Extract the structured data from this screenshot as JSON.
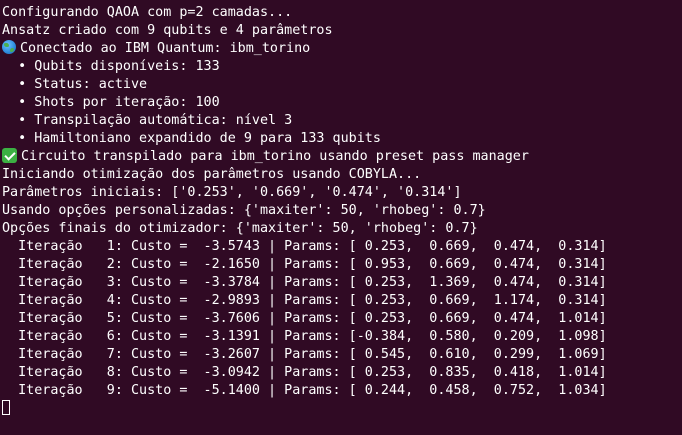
{
  "colors": {
    "background": "#300a24",
    "foreground": "#ffffff"
  },
  "output": {
    "l1": "Configurando QAOA com p=2 camadas...",
    "l2": "Ansatz criado com 9 qubits e 4 parâmetros",
    "l3_icon": "globe-icon",
    "l3": "Conectado ao IBM Quantum: ibm_torino",
    "l4": "  • Qubits disponíveis: 133",
    "l5": "  • Status: active",
    "l6": "  • Shots por iteração: 100",
    "l7": "  • Transpilação automática: nível 3",
    "l8": "  • Hamiltoniano expandido de 9 para 133 qubits",
    "l9_icon": "check-icon",
    "l9": "Circuito transpilado para ibm_torino usando preset pass manager",
    "l10": "Iniciando otimização dos parâmetros usando COBYLA...",
    "l11": "Parâmetros iniciais: ['0.253', '0.669', '0.474', '0.314']",
    "l12": "Usando opções personalizadas: {'maxiter': 50, 'rhobeg': 0.7}",
    "l13": "Opções finais do otimizador: {'maxiter': 50, 'rhobeg': 0.7}"
  },
  "iterations": [
    "  Iteração   1: Custo =  -3.5743 | Params: [ 0.253,  0.669,  0.474,  0.314]",
    "  Iteração   2: Custo =  -2.1650 | Params: [ 0.953,  0.669,  0.474,  0.314]",
    "  Iteração   3: Custo =  -3.3784 | Params: [ 0.253,  1.369,  0.474,  0.314]",
    "  Iteração   4: Custo =  -2.9893 | Params: [ 0.253,  0.669,  1.174,  0.314]",
    "  Iteração   5: Custo =  -3.7606 | Params: [ 0.253,  0.669,  0.474,  1.014]",
    "  Iteração   6: Custo =  -3.1391 | Params: [-0.384,  0.580,  0.209,  1.098]",
    "  Iteração   7: Custo =  -3.2607 | Params: [ 0.545,  0.610,  0.299,  1.069]",
    "  Iteração   8: Custo =  -3.0942 | Params: [ 0.253,  0.835,  0.418,  1.014]",
    "  Iteração   9: Custo =  -5.1400 | Params: [ 0.244,  0.458,  0.752,  1.034]"
  ]
}
